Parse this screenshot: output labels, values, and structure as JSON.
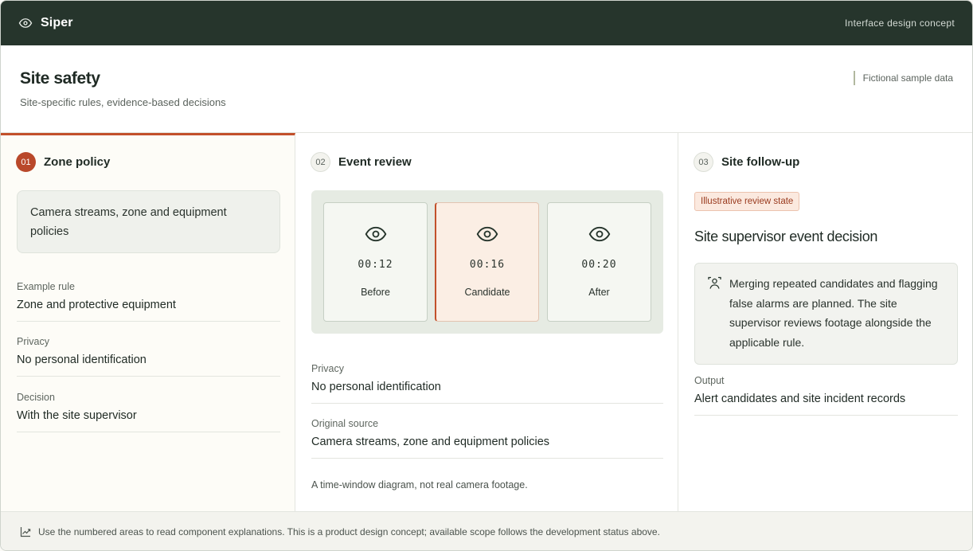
{
  "app": {
    "brand": "Siper",
    "concept_label": "Interface design concept"
  },
  "header": {
    "title": "Site safety",
    "subtitle": "Site-specific rules, evidence-based decisions",
    "sample_tag": "Fictional sample data"
  },
  "step1": {
    "number": "01",
    "title": "Zone policy",
    "card_text": "Camera streams, zone and equipment policies",
    "fields": [
      {
        "label": "Example rule",
        "value": "Zone and protective equipment"
      },
      {
        "label": "Privacy",
        "value": "No personal identification"
      },
      {
        "label": "Decision",
        "value": "With the site supervisor"
      }
    ]
  },
  "step2": {
    "number": "02",
    "title": "Event review",
    "frames": [
      {
        "time": "00:12",
        "label": "Before"
      },
      {
        "time": "00:16",
        "label": "Candidate"
      },
      {
        "time": "00:20",
        "label": "After"
      }
    ],
    "fields": [
      {
        "label": "Privacy",
        "value": "No personal identification"
      },
      {
        "label": "Original source",
        "value": "Camera streams, zone and equipment policies"
      }
    ],
    "note": "A time-window diagram, not real camera footage."
  },
  "step3": {
    "number": "03",
    "title": "Site follow-up",
    "badge": "Illustrative review state",
    "decision_title": "Site supervisor event decision",
    "decision_text": "Merging repeated candidates and flagging false alarms are planned. The site supervisor reviews footage alongside the applicable rule.",
    "fields": [
      {
        "label": "Output",
        "value": "Alert candidates and site incident records"
      }
    ]
  },
  "footer": {
    "text": "Use the numbered areas to read component explanations. This is a product design concept; available scope follows the development status above."
  },
  "colors": {
    "topbar": "#26352c",
    "accent": "#c2502b",
    "panel": "#eff1ec"
  },
  "icons": {
    "brand": "eye-icon",
    "frame": "eye-icon",
    "reviewer": "person-icon",
    "footer": "chart-icon"
  }
}
